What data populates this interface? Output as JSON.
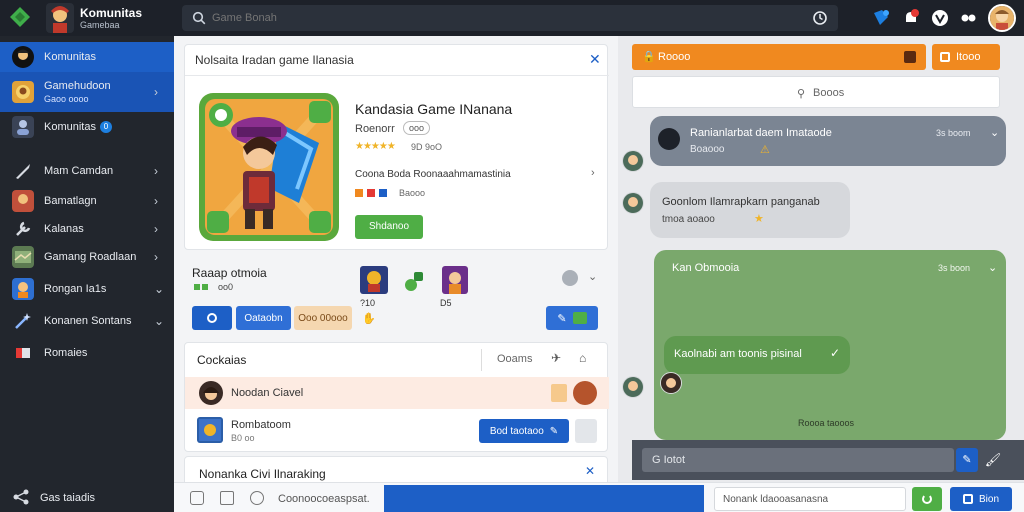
{
  "topbar": {
    "brand": "Komunitas",
    "subtitle": "Gamebaa",
    "search_placeholder": "Game Bonah"
  },
  "sidebar": {
    "items": [
      {
        "label": "Komunitas"
      },
      {
        "label": "Gamehudoon",
        "sublabel": "Gaoo oooo"
      },
      {
        "label": "Komunitas",
        "badge": "0"
      },
      {
        "label": "Mam Camdan"
      },
      {
        "label": "Bamatlagn"
      },
      {
        "label": "Kalanas"
      },
      {
        "label": "Gamang Roadlaan"
      },
      {
        "label": "Rongan Ia1s"
      },
      {
        "label": "Konanen Sontans"
      },
      {
        "label": "Romaies"
      }
    ],
    "footer_label": "Gas taiadis"
  },
  "game_card": {
    "header": "Nolsaita Iradan game Ilanasia",
    "title": "Kandasia Game INanana",
    "meta_label": "Roenorr",
    "meta_badge": "ooo",
    "rating_text": "9D 9oO",
    "tags_line": "Coona Boda  Roonaaahmamastinia",
    "sub_line": "Baooo",
    "action_label": "Shdanoo"
  },
  "ranking": {
    "title": "Raaap otmoia",
    "sub": "oo0",
    "item_counts": [
      "?10",
      "D5"
    ],
    "tabs": [
      "",
      "Oataobn",
      "Ooo 00ooo"
    ]
  },
  "cookies_panel": {
    "title": "Cockaias",
    "right_label": "Ooams",
    "rows": [
      {
        "name": "Noodan Ciavel"
      },
      {
        "name": "Rombatoom",
        "sub": "B0 oo"
      }
    ],
    "row_button": "Bod taotaoo"
  },
  "bottom_card": {
    "title": "Nonanka Civi Ilnaraking"
  },
  "bottombar": {
    "input_text": "Coonoocoeaspsat.",
    "right_input": "Nonank ldaooasanasna",
    "send_label": "Bion"
  },
  "chat": {
    "top_left_btn": "Roooo",
    "top_right_btn": "Itooo",
    "search_label": "Booos",
    "messages": [
      {
        "title": "Ranianlarbat daem Imataode",
        "meta": "3s boom",
        "sub": "Boaooo"
      },
      {
        "title": "Goonlom Ilamrapkarn panganab",
        "sub": "tmoa aoaoo"
      },
      {
        "title": "Kan Obmooia",
        "meta": "3s boon"
      }
    ],
    "inner_bubble": "Kaolnabi am toonis pisinal",
    "inner_footer": "Roooa taooos",
    "composer": "G Iotot"
  },
  "colors": {
    "blue": "#1d5fc6",
    "orange": "#f0891f",
    "green": "#4fae45",
    "dark": "#22262d"
  }
}
